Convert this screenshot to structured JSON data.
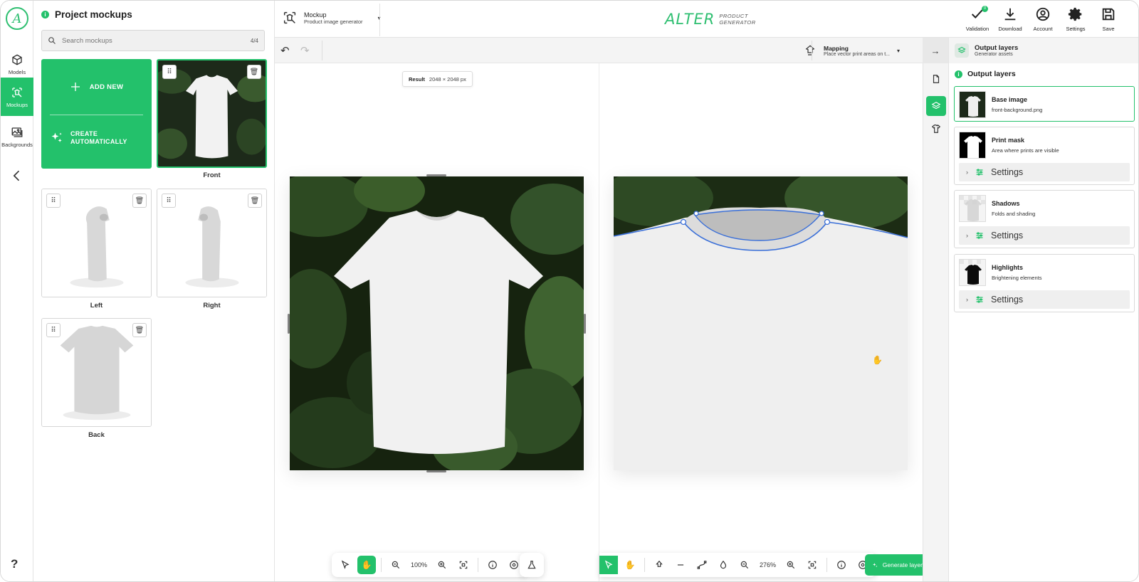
{
  "app": {
    "logo_letter": "A",
    "brand_main": "ALTER",
    "brand_sub_line1": "PRODUCT",
    "brand_sub_line2": "GENERATOR",
    "accent_color": "#23c16b"
  },
  "rail": {
    "items": [
      {
        "label": "Models",
        "icon": "cube-icon"
      },
      {
        "label": "Mockups",
        "icon": "mockup-icon",
        "active": true
      },
      {
        "label": "Backgrounds",
        "icon": "image-icon"
      }
    ],
    "help": "?"
  },
  "mockups_panel": {
    "title": "Project mockups",
    "search_placeholder": "Search mockups",
    "count": "4/4",
    "add_new": "ADD NEW",
    "create_line1": "CREATE",
    "create_line2": "AUTOMATICALLY",
    "cards": [
      {
        "label": "Front",
        "selected": true
      },
      {
        "label": "Left"
      },
      {
        "label": "Right"
      },
      {
        "label": "Back"
      }
    ]
  },
  "topbar": {
    "mockup_title": "Mockup",
    "mockup_sub": "Product image generator",
    "tools": [
      {
        "label": "Validation",
        "icon": "check-icon",
        "badge": "0"
      },
      {
        "label": "Download",
        "icon": "download-icon"
      },
      {
        "label": "Account",
        "icon": "account-icon"
      },
      {
        "label": "Settings",
        "icon": "gear-icon"
      },
      {
        "label": "Save",
        "icon": "save-icon"
      }
    ]
  },
  "canvas": {
    "mapping_title": "Mapping",
    "mapping_sub": "Place vector print areas on t...",
    "result_label": "Result",
    "result_size": "2048 × 2048 px",
    "left_zoom": "100%",
    "right_zoom": "276%",
    "generate_label": "Generate layer"
  },
  "output_panel": {
    "header_title": "Output layers",
    "header_sub": "Generator assets",
    "section_title": "Output layers",
    "settings_label": "Settings",
    "layers": [
      {
        "name": "Base image",
        "desc": "front-background.png",
        "selected": true
      },
      {
        "name": "Print mask",
        "desc": "Area where prints are visible"
      },
      {
        "name": "Shadows",
        "desc": "Folds and shading"
      },
      {
        "name": "Highlights",
        "desc": "Brightening elements"
      }
    ]
  }
}
